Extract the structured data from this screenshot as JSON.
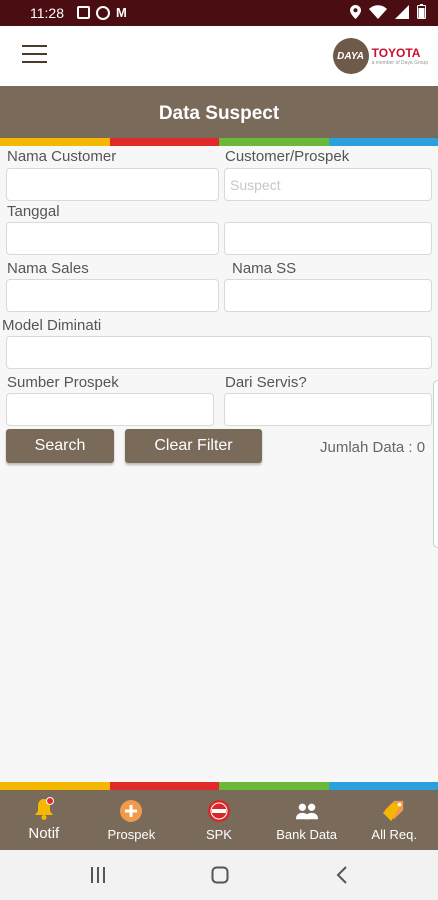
{
  "status_bar": {
    "time": "11:28"
  },
  "header": {
    "title": "Data Suspect",
    "logo_badge": "DAYA",
    "logo_brand": "TOYOTA",
    "logo_tagline": "a member of Daya Group"
  },
  "form": {
    "nama_customer_label": "Nama Customer",
    "nama_customer_value": "",
    "customer_prospek_label": "Customer/Prospek",
    "customer_prospek_placeholder": "Suspect",
    "tanggal_label": "Tanggal",
    "nama_sales_label": "Nama Sales",
    "nama_ss_label": "Nama SS",
    "model_diminati_label": "Model Diminati",
    "sumber_prospek_label": "Sumber Prospek",
    "dari_servis_label": "Dari Servis?"
  },
  "actions": {
    "search_label": "Search",
    "clear_label": "Clear Filter",
    "count_text": "Jumlah Data : 0"
  },
  "bottom_nav": [
    {
      "label": "Notif",
      "icon": "bell-icon"
    },
    {
      "label": "Prospek",
      "icon": "plus-circle-icon"
    },
    {
      "label": "SPK",
      "icon": "spk-badge-icon"
    },
    {
      "label": "Bank Data",
      "icon": "people-icon"
    },
    {
      "label": "All Req.",
      "icon": "tag-icon"
    }
  ],
  "colors": {
    "primary": "#7a6a5a",
    "status_bar": "#4a0d12",
    "stripe": [
      "#f5b800",
      "#e02a2a",
      "#6bb83a",
      "#2aa0dd"
    ]
  }
}
